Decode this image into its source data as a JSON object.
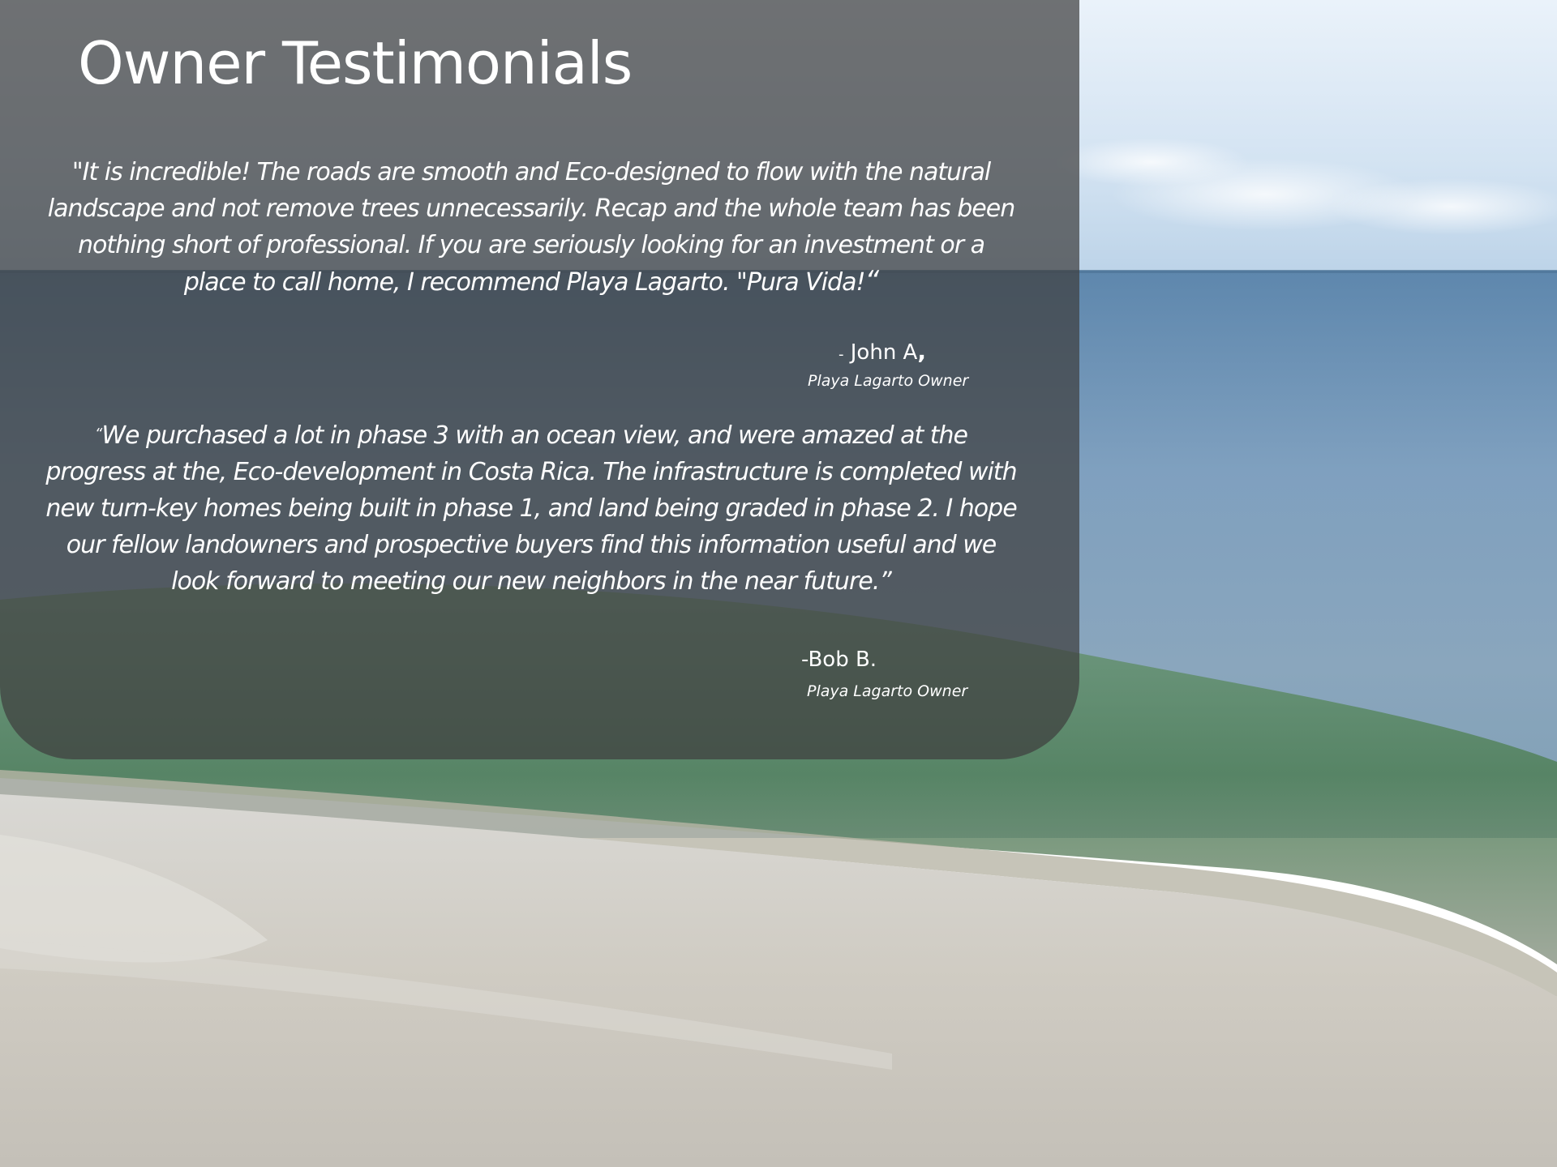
{
  "slide": {
    "title": "Owner Testimonials",
    "background": "beach-ocean-photo"
  },
  "colors": {
    "panel": "#3e3e3e",
    "text": "#ffffff",
    "sky": "#d7e6f3",
    "sea": "#7d9fbd",
    "wave": "#5d8a62",
    "sand": "#c9c6bd"
  },
  "testimonials": [
    {
      "lines": [
        "\"It is incredible! The roads are smooth and Eco-designed to flow with the natural",
        "landscape and not remove trees unnecessarily. Recap and the whole team has been",
        "nothing short of professional. If you are seriously looking for an investment or a",
        "place to call home, I recommend Playa Lagarto. \"Pura Vida!"
      ],
      "closing_mark": "“",
      "author_dash": "-",
      "author_name": " John A",
      "author_comma": ",",
      "author_role": "Playa Lagarto Owner"
    },
    {
      "opening_mark": "“",
      "lines": [
        "We purchased a lot in phase 3 with an ocean view, and were amazed at the",
        "progress at the, Eco-development in Costa Rica. The infrastructure is completed with",
        "new turn-key homes being built in phase 1, and land being graded in phase 2.  I hope",
        "our fellow landowners and prospective buyers find this information useful and we",
        "look forward to meeting our new neighbors in the near future.”"
      ],
      "author_name": "-Bob B.",
      "author_role": "Playa Lagarto Owner"
    }
  ]
}
